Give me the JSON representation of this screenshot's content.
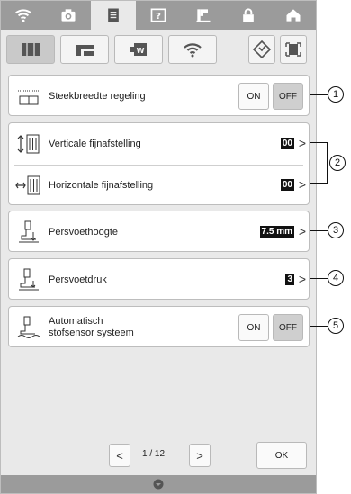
{
  "colors": {
    "bar": "#9b9b9b",
    "screen": "#e9e9e9",
    "value_bg": "#111111"
  },
  "topbar": {
    "tabs": [
      {
        "icon": "wifi-icon"
      },
      {
        "icon": "camera-icon"
      },
      {
        "icon": "document-icon",
        "active": true
      },
      {
        "icon": "help-icon"
      },
      {
        "icon": "sewing-machine-icon"
      },
      {
        "icon": "lock-icon"
      },
      {
        "icon": "home-icon"
      }
    ]
  },
  "subbar": {
    "buttons": [
      {
        "icon": "sewing-settings-icon",
        "selected": true
      },
      {
        "icon": "embroidery-settings-icon"
      },
      {
        "icon": "general-settings-icon"
      },
      {
        "icon": "wlan-settings-icon"
      },
      {
        "icon": "diamond-icon"
      },
      {
        "icon": "frame-icon"
      }
    ]
  },
  "settings": {
    "stitch_width": {
      "label": "Steekbreedte regeling",
      "on": "ON",
      "off": "OFF"
    },
    "vertical": {
      "label": "Verticale fijnafstelling",
      "value": "00"
    },
    "horizontal": {
      "label": "Horizontale fijnafstelling",
      "value": "00"
    },
    "presser_height": {
      "label": "Persvoethoogte",
      "value": "7.5 mm"
    },
    "presser_pressure": {
      "label": "Persvoetdruk",
      "value": "3"
    },
    "fabric_sensor": {
      "label_line1": "Automatisch",
      "label_line2": "stofsensor systeem",
      "on": "ON",
      "off": "OFF"
    }
  },
  "pager": {
    "prev": "<",
    "text": "1 / 12",
    "next": ">",
    "ok": "OK"
  },
  "callouts": [
    "1",
    "2",
    "3",
    "4",
    "5"
  ]
}
